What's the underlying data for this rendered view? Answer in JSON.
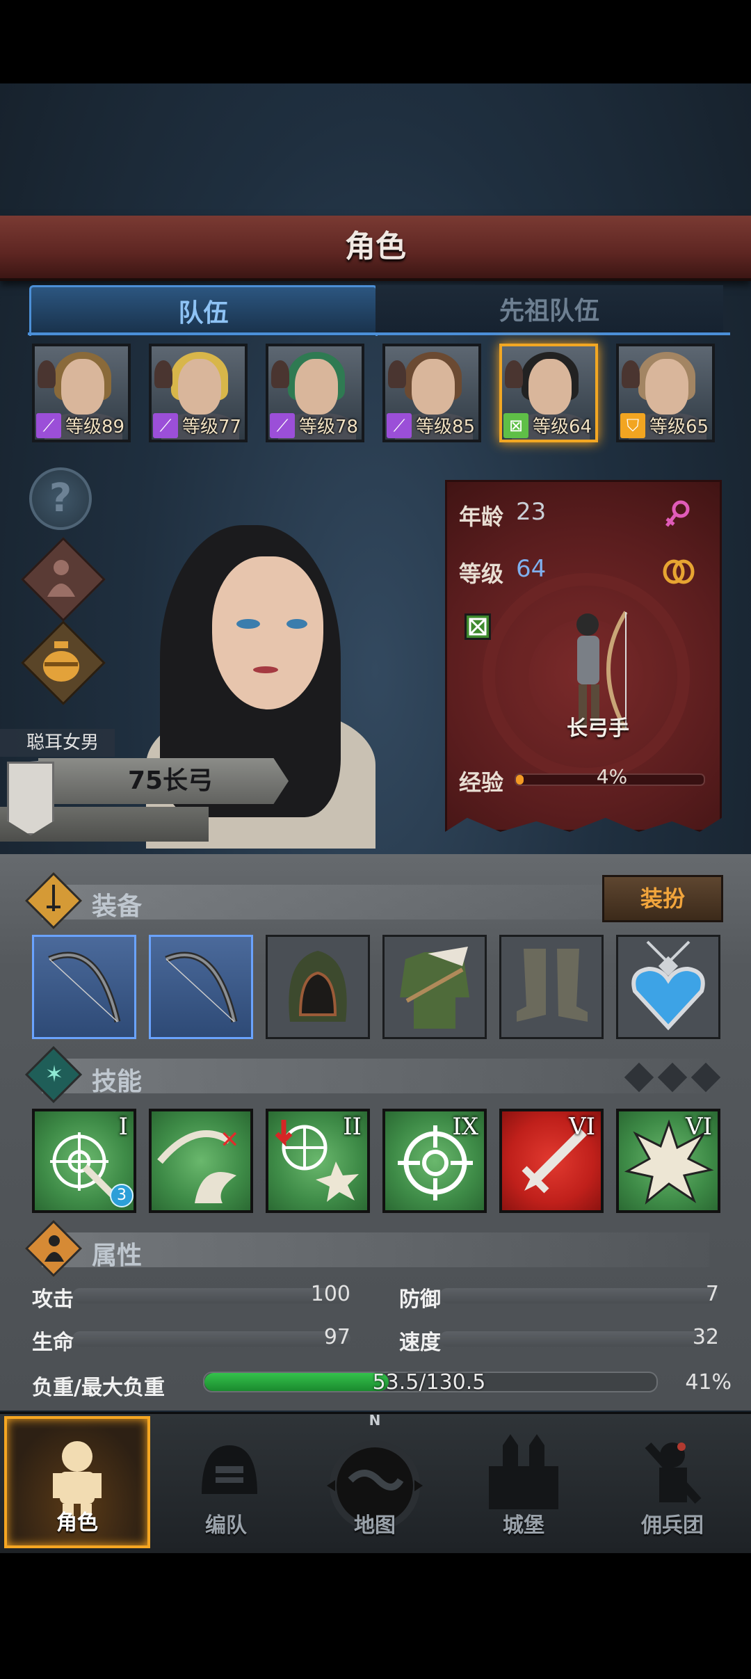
{
  "header": {
    "title": "角色"
  },
  "tabs": [
    {
      "label": "队伍",
      "active": true
    },
    {
      "label": "先祖队伍",
      "active": false
    }
  ],
  "heroes": [
    {
      "level": "等级89",
      "class_color": "#9b4fd8",
      "class_icon": "staff-star-icon",
      "hair": "#8a6a3a",
      "selected": false
    },
    {
      "level": "等级77",
      "class_color": "#9b4fd8",
      "class_icon": "staff-icon",
      "hair": "#d8b64a",
      "selected": false
    },
    {
      "level": "等级78",
      "class_color": "#9b4fd8",
      "class_icon": "staff-icon",
      "hair": "#2f7a52",
      "selected": false
    },
    {
      "level": "等级85",
      "class_color": "#9b4fd8",
      "class_icon": "staff-star-icon",
      "hair": "#6b4a32",
      "selected": false
    },
    {
      "level": "等级64",
      "class_color": "#5fbf47",
      "class_icon": "bow-class-icon",
      "hair": "#222",
      "selected": true
    },
    {
      "level": "等级65",
      "class_color": "#f2a521",
      "class_icon": "shield-class-icon",
      "hair": "#a38563",
      "selected": false
    }
  ],
  "character": {
    "title": "聪耳女男爵",
    "name": "75长弓",
    "age_label": "年龄",
    "age": "23",
    "level_label": "等级",
    "level": "64",
    "class_name": "长弓手",
    "exp_label": "经验",
    "exp_percent": "4%",
    "exp_fraction": 0.04,
    "gender_icon": "female-icon",
    "ring_icon": "ring-icon"
  },
  "equipment": {
    "title": "装备",
    "dress_button": "装扮",
    "slots": [
      "longbow-icon",
      "longbow-icon",
      "hood-icon",
      "tunic-icon",
      "boots-icon",
      "heart-amulet-icon"
    ]
  },
  "skills": {
    "title": "技能",
    "items": [
      {
        "icon": "aimed-shot-icon",
        "rank": "I",
        "badge": "3",
        "color": "green"
      },
      {
        "icon": "bow-strike-icon",
        "rank": "",
        "badge": "",
        "color": "green"
      },
      {
        "icon": "burst-shot-icon",
        "rank": "II",
        "badge": "",
        "color": "green"
      },
      {
        "icon": "crosshair-icon",
        "rank": "IX",
        "badge": "",
        "color": "green"
      },
      {
        "icon": "sword-icon",
        "rank": "VI",
        "badge": "",
        "color": "red"
      },
      {
        "icon": "explosion-icon",
        "rank": "VI",
        "badge": "",
        "color": "green"
      }
    ]
  },
  "attributes": {
    "title": "属性",
    "attack_label": "攻击",
    "attack": "100",
    "defense_label": "防御",
    "defense": "7",
    "hp_label": "生命",
    "hp": "97",
    "speed_label": "速度",
    "speed": "32",
    "weight_label": "负重/最大负重",
    "weight": "53.5/130.5",
    "weight_percent": "41%",
    "weight_fraction": 0.41
  },
  "nav": [
    {
      "label": "角色",
      "icon": "knight-icon",
      "active": true
    },
    {
      "label": "编队",
      "icon": "helmet-icon",
      "active": false
    },
    {
      "label": "地图",
      "icon": "compass-map-icon",
      "active": false,
      "compass": "N"
    },
    {
      "label": "城堡",
      "icon": "castle-icon",
      "active": false
    },
    {
      "label": "佣兵团",
      "icon": "mercenary-icon",
      "active": false
    }
  ]
}
